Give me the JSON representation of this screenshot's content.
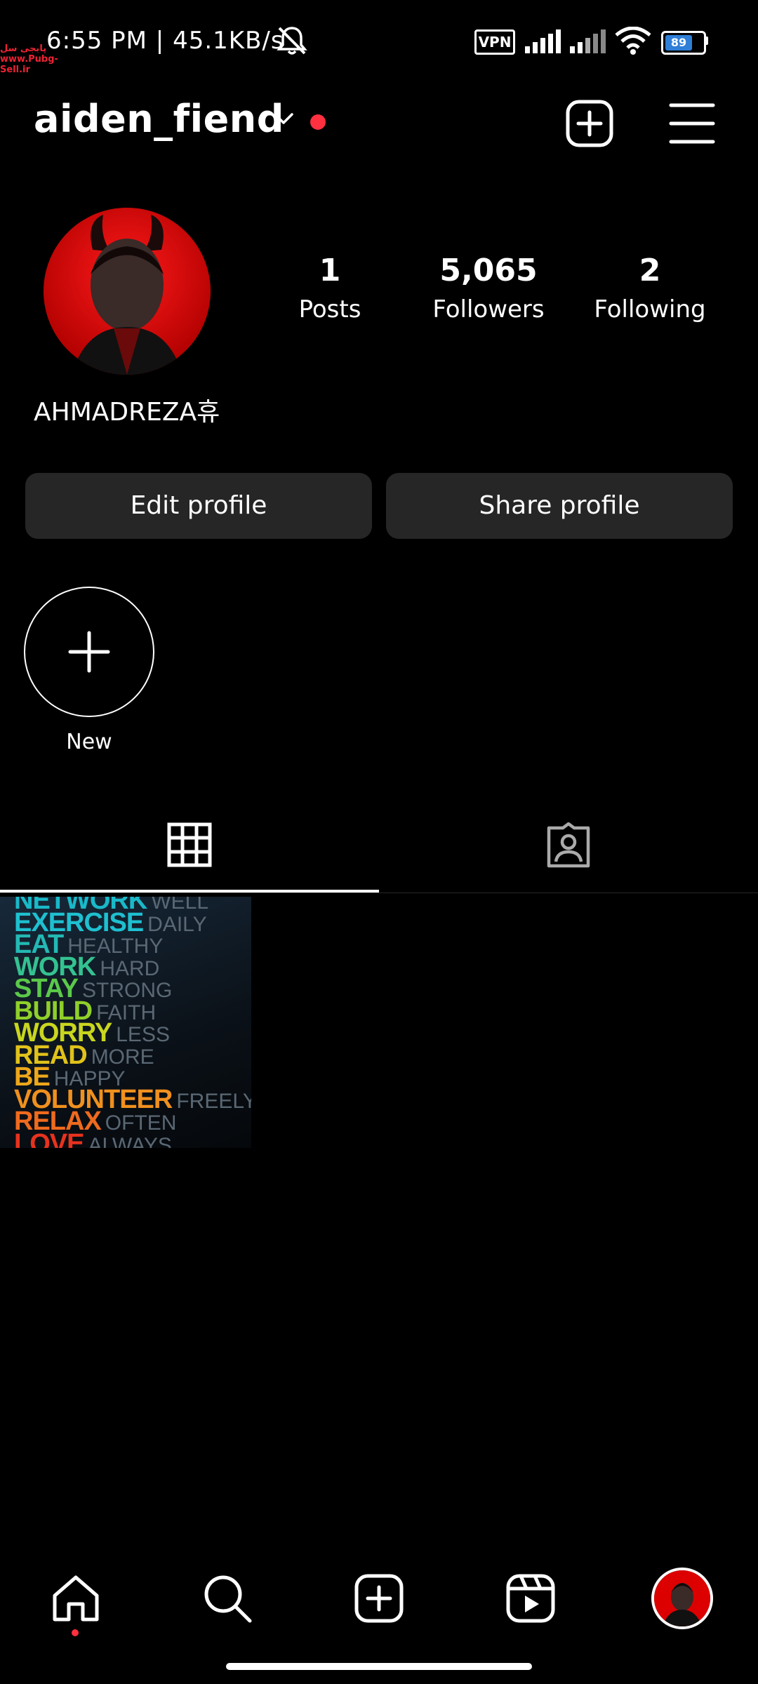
{
  "status_bar": {
    "time_speed": "6:55 PM | 45.1KB/s",
    "watermark": "پابجی سل www.Pubg-Sell.ir",
    "vpn": "VPN",
    "battery": "89",
    "icons": [
      "mute-icon",
      "signal-icon",
      "signal-icon",
      "wifi-icon",
      "battery-icon"
    ]
  },
  "header": {
    "username": "aiden_fiend",
    "icons": [
      "chevron-down-icon",
      "notification-dot",
      "create-post-icon",
      "menu-icon"
    ]
  },
  "profile": {
    "display_name": "AHMADREZA휴",
    "stats": [
      {
        "number": "1",
        "label": "Posts"
      },
      {
        "number": "5,065",
        "label": "Followers"
      },
      {
        "number": "2",
        "label": "Following"
      }
    ],
    "buttons": {
      "edit": "Edit profile",
      "share": "Share profile"
    }
  },
  "highlights": {
    "new_label": "New"
  },
  "tabs": {
    "icons": [
      "grid-icon",
      "tagged-icon"
    ],
    "active": 0
  },
  "post": {
    "lines": [
      {
        "bold": "NETWORK",
        "light": "WELL",
        "color": "#19b9c9"
      },
      {
        "bold": "EXERCISE",
        "light": "DAILY",
        "color": "#1ec0d0"
      },
      {
        "bold": "EAT",
        "light": "HEALTHY",
        "color": "#23b9b4"
      },
      {
        "bold": "WORK",
        "light": "HARD",
        "color": "#34c290"
      },
      {
        "bold": "STAY",
        "light": "STRONG",
        "color": "#5bc94a"
      },
      {
        "bold": "BUILD",
        "light": "FAITH",
        "color": "#8fcf2a"
      },
      {
        "bold": "WORRY",
        "light": "LESS",
        "color": "#c9d61e"
      },
      {
        "bold": "READ",
        "light": "MORE",
        "color": "#e0c21a"
      },
      {
        "bold": "BE",
        "light": "HAPPY",
        "color": "#eda71a"
      },
      {
        "bold": "VOLUNTEER",
        "light": "FREELY",
        "color": "#f0901e"
      },
      {
        "bold": "RELAX",
        "light": "OFTEN",
        "color": "#ef6a1e"
      },
      {
        "bold": "LOVE",
        "light": "ALWAYS",
        "color": "#e8321e"
      }
    ]
  },
  "bottom_nav": {
    "items": [
      "home-icon",
      "search-icon",
      "create-icon",
      "reels-icon",
      "profile-avatar"
    ]
  }
}
